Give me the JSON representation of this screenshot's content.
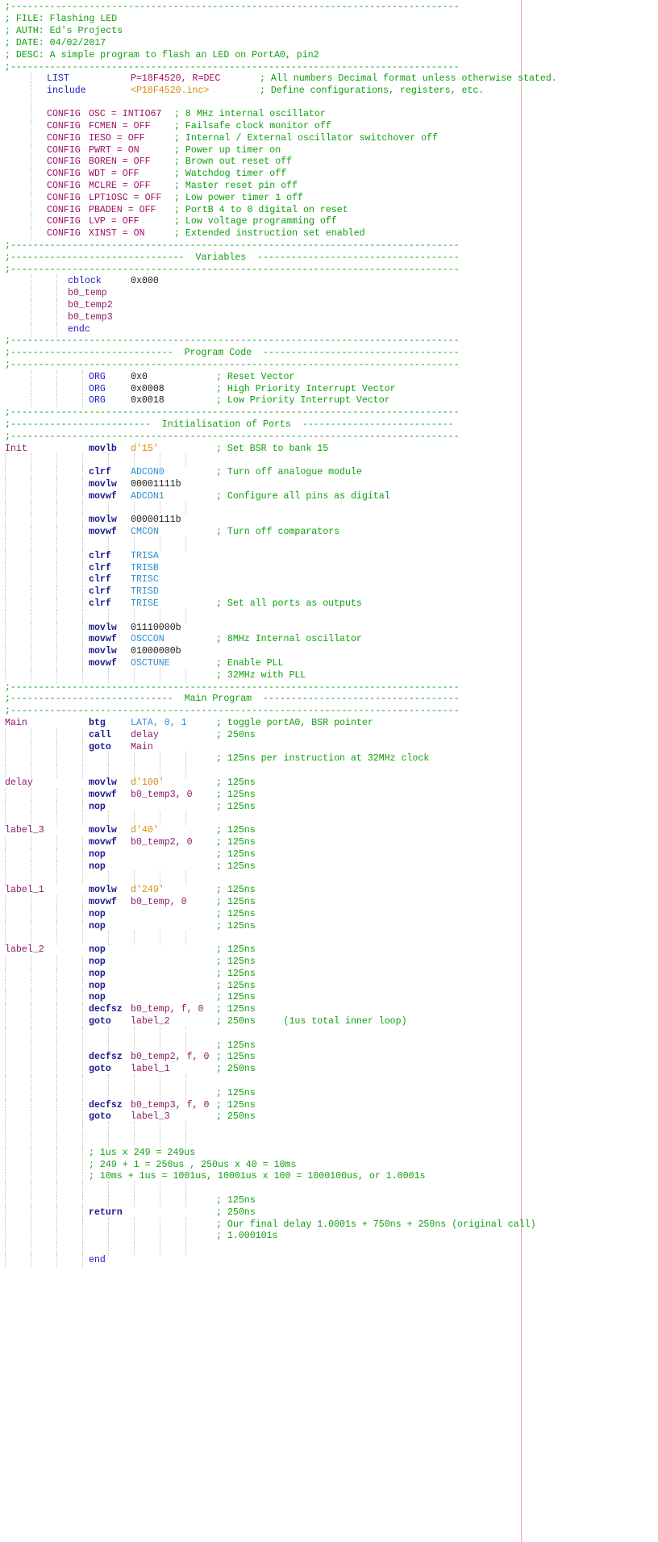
{
  "file": {
    "header": {
      "rule": ";--------------------------------------------------------------------------------",
      "file_line": "; FILE: Flashing LED",
      "auth_line": "; AUTH: Ed's Projects",
      "date_line": "; DATE: 04/02/2017",
      "desc_line": "; DESC: A simple program to flash an LED on PortA0, pin2"
    },
    "directives": [
      {
        "op": "LIST",
        "arg": "P=18F4520, R=DEC",
        "comment": "; All numbers Decimal format unless otherwise stated."
      },
      {
        "op": "include",
        "arg": "<P18F4520.inc>",
        "comment": "; Define configurations, registers, etc."
      }
    ],
    "config": [
      {
        "op": "CONFIG",
        "arg": "OSC = INTIO67",
        "comment": "; 8 MHz internal oscillator"
      },
      {
        "op": "CONFIG",
        "arg": "FCMEN = OFF",
        "comment": "; Failsafe clock monitor off"
      },
      {
        "op": "CONFIG",
        "arg": "IESO = OFF",
        "comment": "; Internal / External oscillator switchover off"
      },
      {
        "op": "CONFIG",
        "arg": "PWRT = ON",
        "comment": "; Power up timer on"
      },
      {
        "op": "CONFIG",
        "arg": "BOREN = OFF",
        "comment": "; Brown out reset off"
      },
      {
        "op": "CONFIG",
        "arg": "WDT = OFF",
        "comment": "; Watchdog timer off"
      },
      {
        "op": "CONFIG",
        "arg": "MCLRE = OFF",
        "comment": "; Master reset pin off"
      },
      {
        "op": "CONFIG",
        "arg": "LPT1OSC = OFF",
        "comment": "; Low power timer 1 off"
      },
      {
        "op": "CONFIG",
        "arg": "PBADEN = OFF",
        "comment": "; PortB 4 to 0 digital on reset"
      },
      {
        "op": "CONFIG",
        "arg": "LVP = OFF",
        "comment": "; Low voltage programming off"
      },
      {
        "op": "CONFIG",
        "arg": "XINST = ON",
        "comment": "; Extended instruction set enabled"
      }
    ],
    "sections": {
      "variables": ";-------------------------------  Variables  ------------------------------------",
      "program_code": ";-----------------------------  Program Code  -----------------------------------",
      "init_ports": ";-------------------------  Initialisation of Ports  ---------------------------",
      "main_program": ";-----------------------------  Main Program  -----------------------------------"
    },
    "variables": {
      "cblock": "cblock",
      "cblock_addr": "0x000",
      "vars": [
        "b0_temp",
        "b0_temp2",
        "b0_temp3"
      ],
      "endc": "endc"
    },
    "org": [
      {
        "op": "ORG",
        "arg": "0x0",
        "comment": "; Reset Vector"
      },
      {
        "op": "ORG",
        "arg": "0x0008",
        "comment": "; High Priority Interrupt Vector"
      },
      {
        "op": "ORG",
        "arg": "0x0018",
        "comment": "; Low Priority Interrupt Vector"
      }
    ],
    "code": [
      {
        "label": "Init",
        "op": "movlb",
        "arg": "d'15'",
        "comment": "; Set BSR to bank 15"
      },
      {},
      {
        "op": "clrf",
        "arg": "ADCON0",
        "comment": "; Turn off analogue module"
      },
      {
        "op": "movlw",
        "arg": "00001111b"
      },
      {
        "op": "movwf",
        "arg": "ADCON1",
        "comment": "; Configure all pins as digital"
      },
      {},
      {
        "op": "movlw",
        "arg": "00000111b"
      },
      {
        "op": "movwf",
        "arg": "CMCON",
        "comment": "; Turn off comparators"
      },
      {},
      {
        "op": "clrf",
        "arg": "TRISA"
      },
      {
        "op": "clrf",
        "arg": "TRISB"
      },
      {
        "op": "clrf",
        "arg": "TRISC"
      },
      {
        "op": "clrf",
        "arg": "TRISD"
      },
      {
        "op": "clrf",
        "arg": "TRISE",
        "comment": "; Set all ports as outputs"
      },
      {},
      {
        "op": "movlw",
        "arg": "01110000b"
      },
      {
        "op": "movwf",
        "arg": "OSCCON",
        "comment": "; 8MHz Internal oscillator"
      },
      {
        "op": "movlw",
        "arg": "01000000b"
      },
      {
        "op": "movwf",
        "arg": "OSCTUNE",
        "comment": "; Enable PLL"
      },
      {
        "comment": "; 32MHz with PLL"
      }
    ],
    "main": [
      {
        "label": "Main",
        "op": "btg",
        "arg": "LATA, 0, 1",
        "comment": "; toggle portA0, BSR pointer"
      },
      {
        "op": "call",
        "arg": "delay",
        "comment": "; 250ns"
      },
      {
        "op": "goto",
        "arg": "Main"
      },
      {
        "comment": "; 125ns per instruction at 32MHz clock"
      },
      {},
      {
        "label": "delay",
        "op": "movlw",
        "arg": "d'100'",
        "comment": "; 125ns"
      },
      {
        "op": "movwf",
        "arg": "b0_temp3, 0",
        "comment": "; 125ns"
      },
      {
        "op": "nop",
        "comment": "; 125ns"
      },
      {},
      {
        "label": "label_3",
        "op": "movlw",
        "arg": "d'40'",
        "comment": "; 125ns"
      },
      {
        "op": "movwf",
        "arg": "b0_temp2, 0",
        "comment": "; 125ns"
      },
      {
        "op": "nop",
        "comment": "; 125ns"
      },
      {
        "op": "nop",
        "comment": "; 125ns"
      },
      {},
      {
        "label": "label_1",
        "op": "movlw",
        "arg": "d'249'",
        "comment": "; 125ns"
      },
      {
        "op": "movwf",
        "arg": "b0_temp, 0",
        "comment": "; 125ns"
      },
      {
        "op": "nop",
        "comment": "; 125ns"
      },
      {
        "op": "nop",
        "comment": "; 125ns"
      },
      {},
      {
        "label": "label_2",
        "op": "nop",
        "comment": "; 125ns"
      },
      {
        "op": "nop",
        "comment": "; 125ns"
      },
      {
        "op": "nop",
        "comment": "; 125ns"
      },
      {
        "op": "nop",
        "comment": "; 125ns"
      },
      {
        "op": "nop",
        "comment": "; 125ns"
      },
      {
        "op": "decfsz",
        "arg": "b0_temp, f, 0",
        "comment": "; 125ns"
      },
      {
        "op": "goto",
        "arg": "label_2",
        "comment": "; 250ns     (1us total inner loop)"
      },
      {},
      {
        "comment": "; 125ns"
      },
      {
        "op": "decfsz",
        "arg": "b0_temp2, f, 0",
        "comment": "; 125ns"
      },
      {
        "op": "goto",
        "arg": "label_1",
        "comment": "; 250ns"
      },
      {},
      {
        "comment": "; 125ns"
      },
      {
        "op": "decfsz",
        "arg": "b0_temp3, f, 0",
        "comment": "; 125ns"
      },
      {
        "op": "goto",
        "arg": "label_3",
        "comment": "; 250ns"
      },
      {},
      {},
      {
        "note": "; 1us x 249 = 249us"
      },
      {
        "note": "; 249 + 1 = 250us , 250us x 40 = 10ms"
      },
      {
        "note": "; 10ms + 1us = 1001us, 10001us x 100 = 1000100us, or 1.0001s"
      },
      {},
      {
        "comment": "; 125ns"
      },
      {
        "op": "return",
        "comment": "; 250ns"
      },
      {
        "comment": "; Our final delay 1.0001s + 750ns + 250ns (original call)"
      },
      {
        "comment": "; 1.000101s"
      },
      {},
      {
        "op_end": "end"
      }
    ]
  }
}
